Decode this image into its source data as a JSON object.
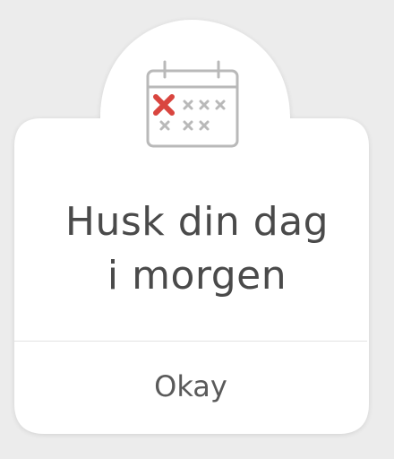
{
  "dialog": {
    "message_line1": "Husk din dag",
    "message_line2": "i morgen",
    "okay_label": "Okay",
    "icon": "calendar-missed-day-icon"
  },
  "colors": {
    "background": "#ececec",
    "card": "#ffffff",
    "text": "#4a4a4a",
    "icon_stroke": "#b9b9b9",
    "accent_cross": "#d9453f",
    "divider": "#e2e2e2"
  }
}
